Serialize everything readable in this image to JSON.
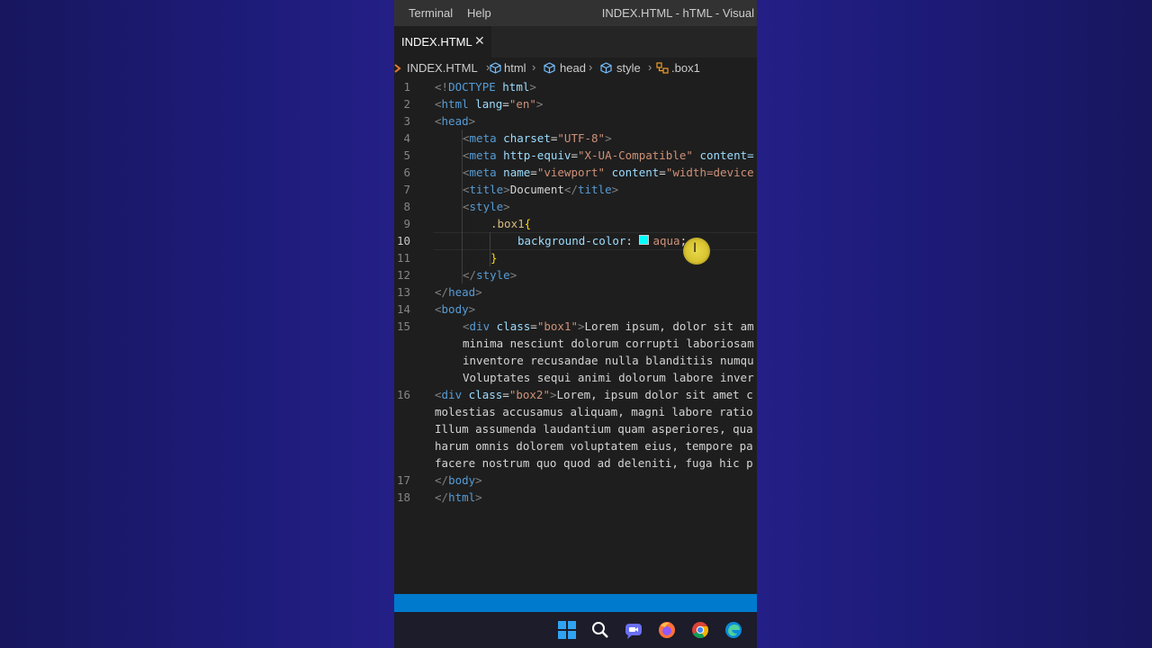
{
  "menu": {
    "terminal": "Terminal",
    "help": "Help"
  },
  "window_title": "INDEX.HTML - hTML - Visual",
  "tab": {
    "label": "INDEX.HTML",
    "close": "✕"
  },
  "breadcrumb": {
    "file": "INDEX.HTML",
    "html": "html",
    "head": "head",
    "style": "style",
    "selector": ".box1"
  },
  "editor": {
    "active_line": 10,
    "line_numbers": [
      "1",
      "2",
      "3",
      "4",
      "5",
      "6",
      "7",
      "8",
      "9",
      "10",
      "11",
      "12",
      "13",
      "14",
      "15",
      "16",
      "17",
      "18"
    ],
    "lines": {
      "l1": [
        "<!",
        "DOCTYPE",
        " ",
        "html",
        ">"
      ],
      "l2": [
        "<",
        "html",
        " ",
        "lang",
        "=",
        "\"en\"",
        ">"
      ],
      "l3": [
        "<",
        "head",
        ">"
      ],
      "l4": [
        "<",
        "meta",
        " ",
        "charset",
        "=",
        "\"UTF-8\"",
        ">"
      ],
      "l5": [
        "<",
        "meta",
        " ",
        "http-equiv",
        "=",
        "\"X-UA-Compatible\"",
        " ",
        "content="
      ],
      "l6": [
        "<",
        "meta",
        " ",
        "name",
        "=",
        "\"viewport\"",
        " ",
        "content",
        "=",
        "\"width=device"
      ],
      "l7": [
        "<",
        "title",
        ">",
        "Document",
        "</",
        "title",
        ">"
      ],
      "l8": [
        "<",
        "style",
        ">"
      ],
      "l9": [
        ".box1",
        "{"
      ],
      "l10": [
        "background-color",
        ": ",
        "aqua",
        ";"
      ],
      "l11": [
        "}"
      ],
      "l12": [
        "</",
        "style",
        ">"
      ],
      "l13": [
        "</",
        "head",
        ">"
      ],
      "l14": [
        "<",
        "body",
        ">"
      ],
      "l15": [
        "<",
        "div",
        " ",
        "class",
        "=",
        "\"box1\"",
        ">",
        "Lorem ipsum, dolor sit am"
      ],
      "l15b": "minima nesciunt dolorum corrupti laboriosam",
      "l15c": "inventore recusandae nulla blanditiis numqu",
      "l15d": "Voluptates sequi animi dolorum labore inver",
      "l16": [
        "<",
        "div",
        " ",
        "class",
        "=",
        "\"box2\"",
        ">",
        "Lorem, ipsum dolor sit amet c"
      ],
      "l16b": "molestias accusamus aliquam, magni labore ratio",
      "l16c": "Illum assumenda laudantium quam asperiores, qua",
      "l16d": "harum omnis dolorem voluptatem eius, tempore pa",
      "l16e": "facere nostrum quo quod ad deleniti, fuga hic p",
      "l17": [
        "</",
        "body",
        ">"
      ],
      "l18": [
        "</",
        "html",
        ">"
      ]
    }
  },
  "colors": {
    "swatch": "#00ffff",
    "statusbar": "#007acc",
    "accent_cursor": "#e8d84a"
  },
  "taskbar_icons": [
    "windows-start-icon",
    "search-icon",
    "chat-icon",
    "firefox-icon",
    "chrome-icon",
    "edge-icon"
  ]
}
